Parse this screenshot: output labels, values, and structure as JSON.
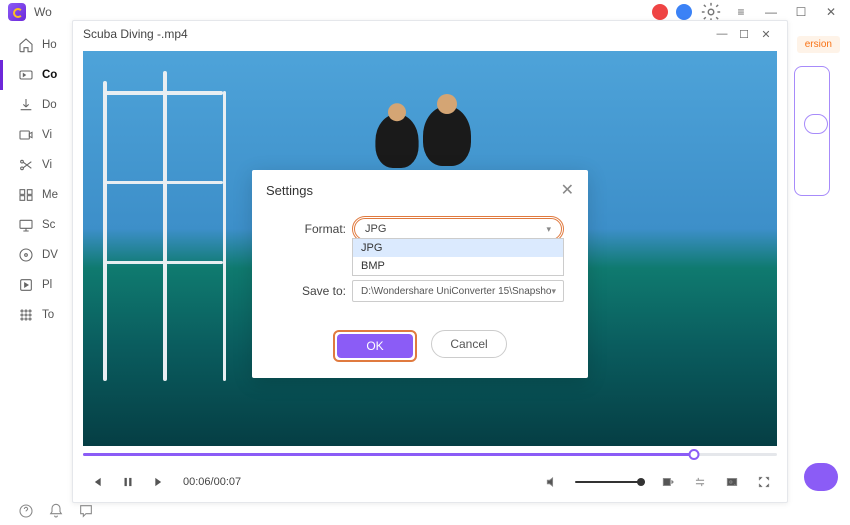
{
  "titlebar": {
    "app_label": "Wo"
  },
  "sidebar": {
    "items": [
      {
        "label": "Ho"
      },
      {
        "label": "Co"
      },
      {
        "label": "Do"
      },
      {
        "label": "Vi"
      },
      {
        "label": "Vi"
      },
      {
        "label": "Me"
      },
      {
        "label": "Sc"
      },
      {
        "label": "DV"
      },
      {
        "label": "Pl"
      },
      {
        "label": "To"
      }
    ]
  },
  "right_badge": "ersion",
  "video_window": {
    "title": "Scuba Diving -.mp4",
    "time": "00:06/00:07"
  },
  "modal": {
    "title": "Settings",
    "format_label": "Format:",
    "format_value": "JPG",
    "format_options": [
      "JPG",
      "BMP"
    ],
    "saveto_label": "Save to:",
    "saveto_value": "D:\\Wondershare UniConverter 15\\Snapsho",
    "ok_label": "OK",
    "cancel_label": "Cancel"
  }
}
